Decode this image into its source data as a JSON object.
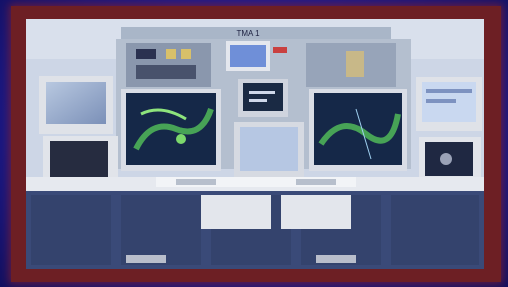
{
  "photo": {
    "console_label": "TMA 1"
  }
}
